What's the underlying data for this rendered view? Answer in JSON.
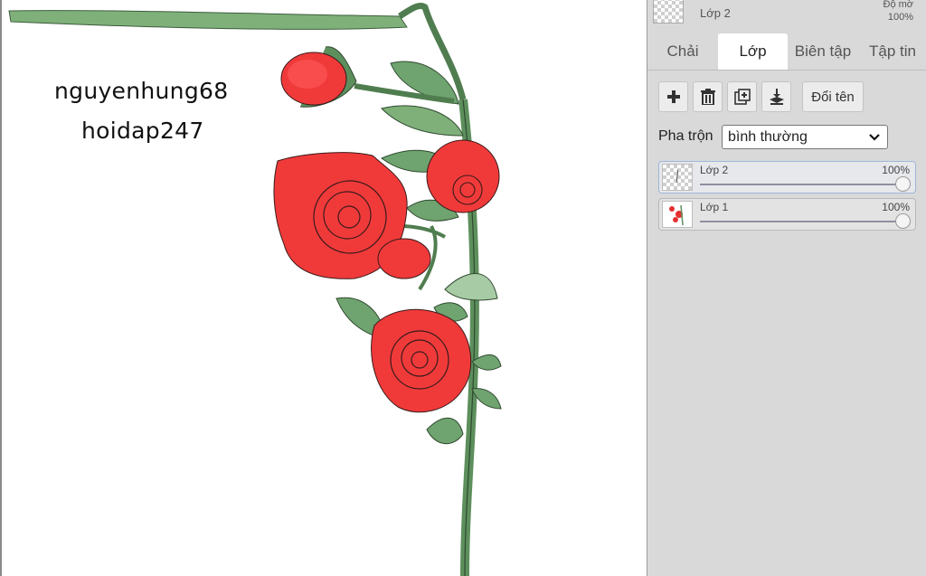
{
  "canvas": {
    "signature_user": "nguyenhung68",
    "signature_site": "hoidap247"
  },
  "top_layer": {
    "name": "Lớp 2",
    "opacity_label": "Độ mờ",
    "opacity_value": "100%"
  },
  "tabs": [
    {
      "label": "Chải",
      "active": false
    },
    {
      "label": "Lớp",
      "active": true
    },
    {
      "label": "Biên tập",
      "active": false
    },
    {
      "label": "Tập tin",
      "active": false
    }
  ],
  "toolbar": {
    "add_icon": "plus-icon",
    "delete_icon": "trash-icon",
    "duplicate_icon": "duplicate-icon",
    "merge_icon": "merge-down-icon",
    "rename_label": "Đổi tên"
  },
  "blend": {
    "label": "Pha trộn",
    "value": "bình thường"
  },
  "layers": [
    {
      "name": "Lớp 2",
      "opacity": "100%",
      "selected": true,
      "opacity_fraction": 1.0
    },
    {
      "name": "Lớp 1",
      "opacity": "100%",
      "selected": false,
      "opacity_fraction": 1.0
    }
  ],
  "colors": {
    "panel_bg": "#d9d9d9",
    "rose_red": "#f03a3a",
    "leaf_green": "#6fa36f",
    "accent_border": "#9fb6da"
  }
}
